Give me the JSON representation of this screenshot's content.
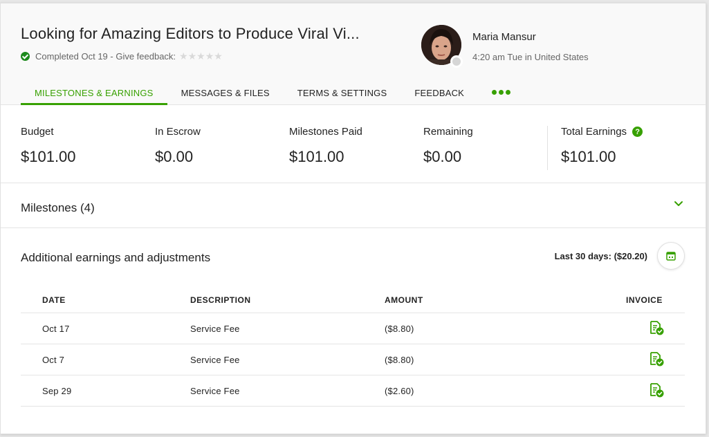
{
  "header": {
    "title": "Looking for Amazing Editors to Produce Viral Vi...",
    "status": "Completed Oct 19 - Give feedback:",
    "rating_stars": "★★★★★"
  },
  "user": {
    "name": "Maria Mansur",
    "time": "4:20 am Tue in United States"
  },
  "tabs": [
    {
      "label": "MILESTONES & EARNINGS"
    },
    {
      "label": "MESSAGES & FILES"
    },
    {
      "label": "TERMS & SETTINGS"
    },
    {
      "label": "FEEDBACK"
    }
  ],
  "stats": [
    {
      "label": "Budget",
      "value": "$101.00"
    },
    {
      "label": "In Escrow",
      "value": "$0.00"
    },
    {
      "label": "Milestones Paid",
      "value": "$101.00"
    },
    {
      "label": "Remaining",
      "value": "$0.00"
    },
    {
      "label": "Total Earnings",
      "value": "$101.00",
      "help": "?"
    }
  ],
  "milestones": {
    "title": "Milestones (4)"
  },
  "additional": {
    "title": "Additional earnings and adjustments",
    "summary": "Last 30 days: ($20.20)"
  },
  "table": {
    "headers": {
      "date": "DATE",
      "description": "DESCRIPTION",
      "amount": "AMOUNT",
      "invoice": "INVOICE"
    },
    "rows": [
      {
        "date": "Oct 17",
        "description": "Service Fee",
        "amount": "($8.80)"
      },
      {
        "date": "Oct 7",
        "description": "Service Fee",
        "amount": "($8.80)"
      },
      {
        "date": "Sep 29",
        "description": "Service Fee",
        "amount": "($2.60)"
      }
    ]
  },
  "colors": {
    "accent": "#37a000",
    "success": "#1d8a1d"
  },
  "icons": {
    "status": "check-circle-icon",
    "help": "help-icon",
    "chevron": "chevron-down-icon",
    "calendar": "calendar-icon",
    "invoice": "invoice-check-icon",
    "more": "more-dots-icon"
  }
}
